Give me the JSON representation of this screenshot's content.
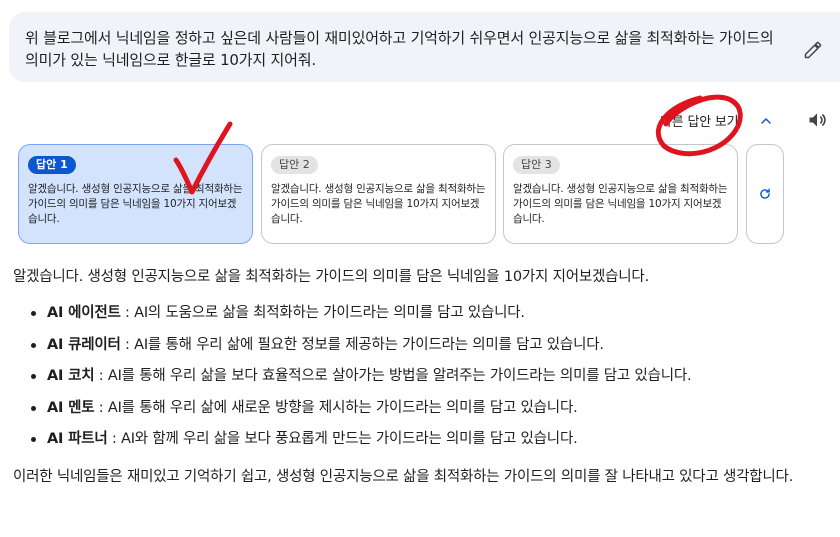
{
  "prompt": {
    "text": "위 블로그에서 닉네임을 정하고 싶은데 사람들이 재미있어하고 기억하기 쉬우면서 인공지능으로 삶을 최적화하는 가이드의 의미가 있는 닉네임으로 한글로 10가지 지어줘.",
    "edit_icon": "pencil-icon"
  },
  "drafts": {
    "header_label": "다른 답안 보기",
    "chevron_icon": "chevron-up-icon",
    "speaker_icon": "speaker-icon",
    "regenerate_icon": "refresh-icon",
    "items": [
      {
        "chip": "답안 1",
        "text": "알겠습니다. 생성형 인공지능으로 삶을 최적화하는 가이드의 의미를 담은 닉네임을 10가지 지어보겠습니다.",
        "selected": true
      },
      {
        "chip": "답안 2",
        "text": "알겠습니다. 생성형 인공지능으로 삶을 최적화하는 가이드의 의미를 담은 닉네임을 10가지 지어보겠습니다.",
        "selected": false
      },
      {
        "chip": "답안 3",
        "text": "알겠습니다. 생성형 인공지능으로 삶을 최적화하는 가이드의 의미를 담은 닉네임을 10가지 지어보겠습니다.",
        "selected": false
      }
    ]
  },
  "response": {
    "intro": "알겠습니다. 생성형 인공지능으로 삶을 최적화하는 가이드의 의미를 담은 닉네임을 10가지 지어보겠습니다.",
    "items": [
      {
        "name": "AI 에이전트",
        "desc": " : AI의 도움으로 삶을 최적화하는 가이드라는 의미를 담고 있습니다."
      },
      {
        "name": "AI 큐레이터",
        "desc": " : AI를 통해 우리 삶에 필요한 정보를 제공하는 가이드라는 의미를 담고 있습니다."
      },
      {
        "name": "AI 코치",
        "desc": " : AI를 통해 우리 삶을 보다 효율적으로 살아가는 방법을 알려주는 가이드라는 의미를 담고 있습니다."
      },
      {
        "name": "AI 멘토",
        "desc": " : AI를 통해 우리 삶에 새로운 방향을 제시하는 가이드라는 의미를 담고 있습니다."
      },
      {
        "name": "AI 파트너",
        "desc": " : AI와 함께 우리 삶을 보다 풍요롭게 만드는 가이드라는 의미를 담고 있습니다."
      }
    ],
    "outro": "이러한 닉네임들은 재미있고 기억하기 쉽고, 생성형 인공지능으로 삶을 최적화하는 가이드의 의미를 잘 나타내고 있다고 생각합니다."
  },
  "annotations": {
    "checkmark_color": "#e0141e",
    "circle_color": "#e0141e"
  },
  "colors": {
    "prompt_bg": "#f0f4f9",
    "selected_card_bg": "#d3e3fd",
    "selected_chip_bg": "#0b57d0"
  }
}
